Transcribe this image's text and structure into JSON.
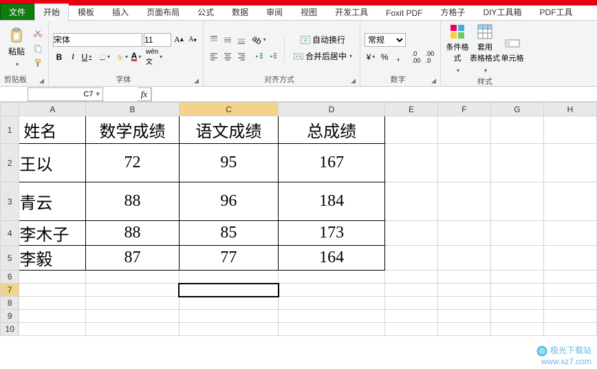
{
  "app": {
    "file_tab": "文件"
  },
  "tabs": [
    "开始",
    "模板",
    "插入",
    "页面布局",
    "公式",
    "数据",
    "审阅",
    "视图",
    "开发工具",
    "Foxit PDF",
    "方格子",
    "DIY工具箱",
    "PDF工具"
  ],
  "active_tab": 0,
  "ribbon": {
    "clipboard": {
      "paste": "粘贴",
      "label": "剪贴板"
    },
    "font": {
      "name": "宋体",
      "size": "11",
      "label": "字体"
    },
    "align": {
      "wrap": "自动换行",
      "merge": "合并后居中",
      "label": "对齐方式"
    },
    "number": {
      "format": "常规",
      "label": "数字"
    },
    "styles": {
      "cond": "条件格式",
      "table": "套用\n表格格式",
      "cell": "单元格",
      "label": "样式"
    }
  },
  "formula_bar": {
    "namebox": "C7",
    "fx": "fx",
    "value": ""
  },
  "columns": [
    "A",
    "B",
    "C",
    "D",
    "E",
    "F",
    "G",
    "H"
  ],
  "chart_data": {
    "type": "table",
    "headers": [
      "姓名",
      "数学成绩",
      "语文成绩",
      "总成绩"
    ],
    "rows": [
      {
        "name": "王以",
        "math": 72,
        "chinese": 95,
        "total": 167
      },
      {
        "name": "青云",
        "math": 88,
        "chinese": 96,
        "total": 184
      },
      {
        "name": "李木子",
        "math": 88,
        "chinese": 85,
        "total": 173
      },
      {
        "name": "李毅",
        "math": 87,
        "chinese": 77,
        "total": 164
      }
    ]
  },
  "selected_cell": "C7",
  "row_count": 10,
  "watermark": {
    "line1": "极光下载站",
    "line2": "www.xz7.com"
  }
}
